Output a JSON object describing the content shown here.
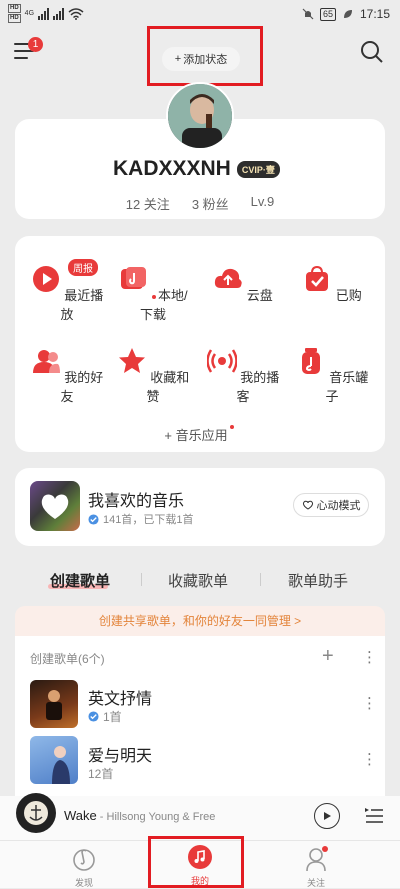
{
  "status_bar": {
    "signal": "4G",
    "battery": "65",
    "time": "17:15"
  },
  "header": {
    "menu_badge": "1",
    "add_status": "添加状态"
  },
  "profile": {
    "username": "KADXXXNH",
    "vip": "CVIP·壹",
    "follow": "12 关注",
    "fans": "3 粉丝",
    "level": "Lv.9"
  },
  "functions": {
    "weekly_badge": "周报",
    "items": [
      {
        "label": "最近播放",
        "icon": "play-icon"
      },
      {
        "label": "本地/下载",
        "icon": "folder-icon"
      },
      {
        "label": "云盘",
        "icon": "cloud-icon"
      },
      {
        "label": "已购",
        "icon": "purchased-icon"
      },
      {
        "label": "我的好友",
        "icon": "friends-icon"
      },
      {
        "label": "收藏和赞",
        "icon": "star-icon"
      },
      {
        "label": "我的播客",
        "icon": "podcast-icon"
      },
      {
        "label": "音乐罐子",
        "icon": "jar-icon"
      }
    ],
    "music_apps": "+ 音乐应用"
  },
  "liked": {
    "title": "我喜欢的音乐",
    "subtitle": "141首，已下载1首",
    "heartbeat": "心动模式"
  },
  "tabs": [
    "创建歌单",
    "收藏歌单",
    "歌单助手"
  ],
  "share_banner": "创建共享歌单，和你的好友一同管理 >",
  "playlists": {
    "header": "创建歌单(6个)",
    "items": [
      {
        "title": "英文抒情",
        "count": "1首"
      },
      {
        "title": "爱与明天",
        "count": "12首"
      }
    ]
  },
  "player": {
    "song": "Wake",
    "artist": " - Hillsong Young & Free"
  },
  "nav": [
    "发现",
    "我的",
    "关注"
  ],
  "colors": {
    "accent": "#e83a3a",
    "outline": "#e21c22"
  }
}
